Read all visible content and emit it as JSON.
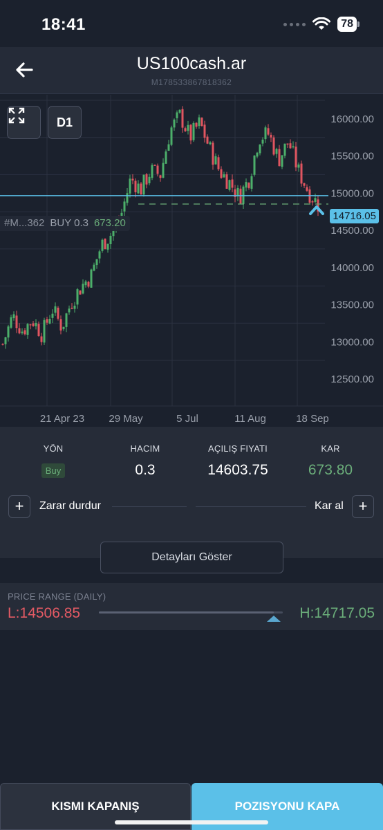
{
  "status_bar": {
    "time": "18:41",
    "battery": "78"
  },
  "header": {
    "title": "US100cash.ar",
    "subtitle": "M178533867818362"
  },
  "chart": {
    "timeframe_label": "D1",
    "current_price_tag": "14716.05",
    "position_line_label": {
      "id": "#M...362",
      "side": "BUY 0.3",
      "pl": "673.20"
    },
    "colors": {
      "up": "#4caf6a",
      "down": "#e05560",
      "price_line": "#5bc0e8",
      "position_line": "#6bae7a"
    }
  },
  "chart_data": {
    "type": "candlestick",
    "timeframe": "D1",
    "x_tick_labels": [
      "21 Apr 23",
      "29 May",
      "5 Jul",
      "11 Aug",
      "18 Sep"
    ],
    "y_tick_labels": [
      "16000.00",
      "15500.00",
      "15000.00",
      "14500.00",
      "14000.00",
      "13500.00",
      "13000.00",
      "12500.00"
    ],
    "y_ticks": [
      16000,
      15500,
      15000,
      14500,
      14000,
      13500,
      13000,
      12500
    ],
    "ylim": [
      12300,
      16100
    ],
    "current_price": 14716.05,
    "entry_price": 14603.75,
    "close_path": [
      12720,
      13100,
      12900,
      13050,
      12850,
      13200,
      12950,
      13300,
      13500,
      13650,
      14050,
      14200,
      14450,
      14950,
      14800,
      15050,
      15000,
      15600,
      15800,
      15500,
      15700,
      15350,
      15050,
      14900,
      14700,
      14950,
      15500,
      15550,
      15200,
      15450,
      15050,
      14780,
      14600
    ]
  },
  "position": {
    "labels": {
      "yon": "YÖN",
      "hacim": "HACIM",
      "acilis": "AÇILIŞ FIYATI",
      "kar": "KAR"
    },
    "side": "Buy",
    "volume": "0.3",
    "open_price": "14603.75",
    "profit": "673.80",
    "stop_loss_label": "Zarar durdur",
    "take_profit_label": "Kar al",
    "plus_symbol": "+"
  },
  "details_button": "Detayları Göster",
  "price_range": {
    "title": "PRICE RANGE (DAILY)",
    "low": "L:14506.85",
    "high": "H:14717.05",
    "position": 0.95
  },
  "actions": {
    "partial_close": "KISMI KAPANIŞ",
    "close_position": "POZISYONU KAPA"
  }
}
